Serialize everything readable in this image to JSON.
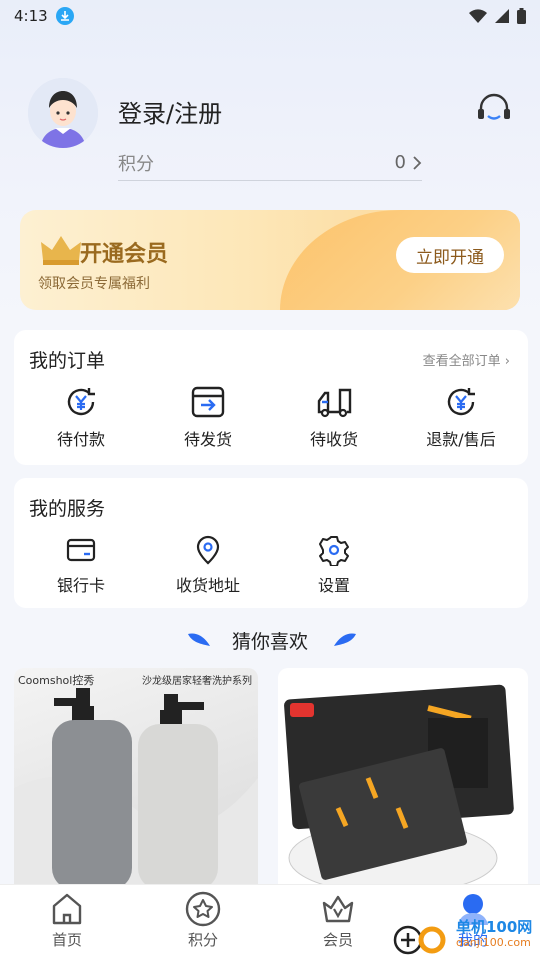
{
  "status_bar": {
    "time": "4:13"
  },
  "header": {
    "login_label": "登录/注册",
    "points_label": "积分",
    "points_value": "0"
  },
  "vip": {
    "title": "开通会员",
    "subtitle": "领取会员专属福利",
    "button_label": "立即开通"
  },
  "orders": {
    "title": "我的订单",
    "view_all": "查看全部订单",
    "items": [
      {
        "label": "待付款",
        "icon": "yuan-clock-icon"
      },
      {
        "label": "待发货",
        "icon": "box-arrow-icon"
      },
      {
        "label": "待收货",
        "icon": "truck-icon"
      },
      {
        "label": "退款/售后",
        "icon": "yuan-refund-icon"
      }
    ]
  },
  "services": {
    "title": "我的服务",
    "items": [
      {
        "label": "银行卡",
        "icon": "card-icon"
      },
      {
        "label": "收货地址",
        "icon": "location-pin-icon"
      },
      {
        "label": "设置",
        "icon": "gear-icon"
      }
    ]
  },
  "recommend": {
    "title": "猜你喜欢",
    "products": [
      {
        "brand": "Coomshol控秀",
        "tag": "沙龙级居家轻奢洗护系列"
      },
      {
        "brand": "",
        "tag": ""
      }
    ]
  },
  "tabbar": {
    "items": [
      {
        "label": "首页",
        "icon": "home-icon"
      },
      {
        "label": "积分",
        "icon": "star-icon"
      },
      {
        "label": "会员",
        "icon": "crown-v-icon"
      },
      {
        "label": "我的",
        "icon": "user-icon"
      }
    ]
  },
  "watermark": {
    "text": "单机100网",
    "url": "danji100.com"
  },
  "colors": {
    "accent": "#2a6bf2",
    "vip_text": "#9a6a1f",
    "vip_bg": "#fde7b8"
  }
}
